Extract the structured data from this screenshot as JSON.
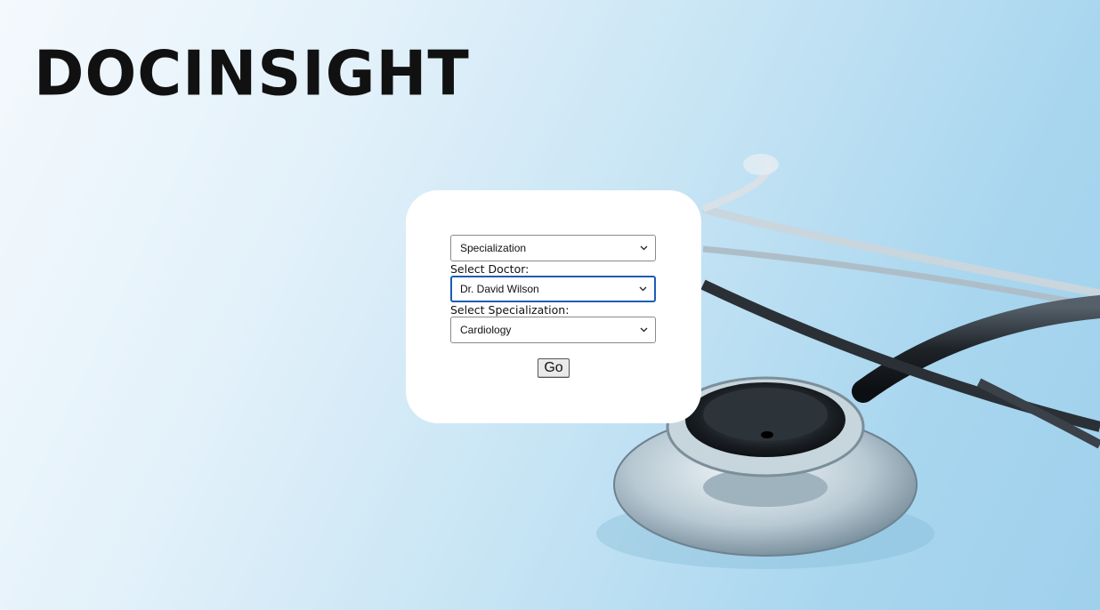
{
  "app": {
    "logo_text": "DOCINSIGHT"
  },
  "form": {
    "specialization_filter": {
      "selected": "Specialization"
    },
    "doctor": {
      "label": "Select Doctor:",
      "selected": "Dr. David Wilson"
    },
    "specialization": {
      "label": "Select Specialization:",
      "selected": "Cardiology"
    },
    "submit_label": "Go"
  },
  "colors": {
    "focus_border": "#1d5bb8",
    "card_background": "#ffffff",
    "background_blue": "#a9d6ef"
  },
  "icons": {
    "dropdown": "chevron-down-icon"
  }
}
